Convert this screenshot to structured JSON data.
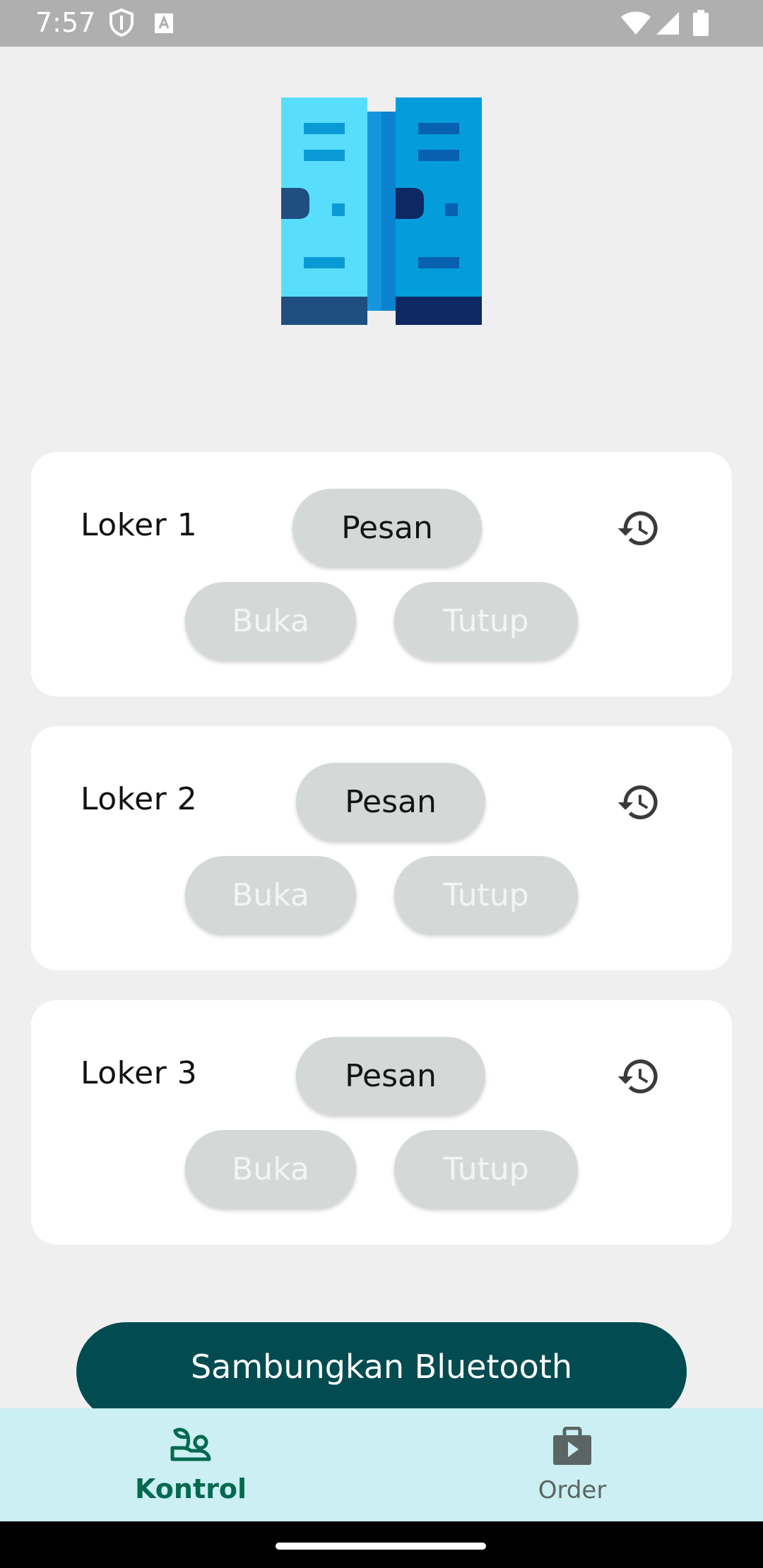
{
  "status_bar": {
    "time": "7:57"
  },
  "lockers": [
    {
      "name": "Loker 1",
      "order_label": "Pesan",
      "open_label": "Buka",
      "close_label": "Tutup"
    },
    {
      "name": "Loker 2",
      "order_label": "Pesan",
      "open_label": "Buka",
      "close_label": "Tutup"
    },
    {
      "name": "Loker 3",
      "order_label": "Pesan",
      "open_label": "Buka",
      "close_label": "Tutup"
    }
  ],
  "connect_button": {
    "label": "Sambungkan Bluetooth"
  },
  "bottom_nav": {
    "items": [
      {
        "label": "Kontrol",
        "icon": "plant-hand-icon",
        "selected": true
      },
      {
        "label": "Order",
        "icon": "shopping-bag-play-icon",
        "selected": false
      }
    ]
  },
  "colors": {
    "background": "#efefef",
    "primary_button": "#024b50",
    "bottom_nav_background": "#cbeff3",
    "nav_selected": "#03694f",
    "pill_background": "#d4d9d8"
  }
}
